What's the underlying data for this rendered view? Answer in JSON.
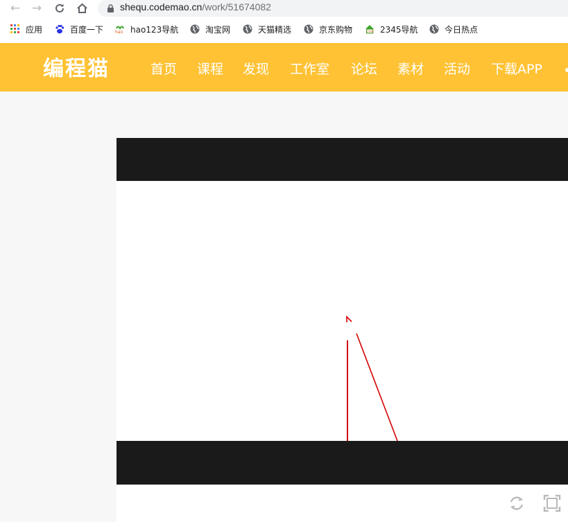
{
  "browser": {
    "url_host": "shequ.codemao.cn",
    "url_path": "/work/51674082",
    "bookmarks": [
      {
        "label": "应用",
        "icon": "apps-grid-icon"
      },
      {
        "label": "百度一下",
        "icon": "baidu-paw-icon"
      },
      {
        "label": "hao123导航",
        "icon": "hao123-icon"
      },
      {
        "label": "淘宝网",
        "icon": "globe-icon"
      },
      {
        "label": "天猫精选",
        "icon": "globe-icon"
      },
      {
        "label": "京东购物",
        "icon": "globe-icon"
      },
      {
        "label": "2345导航",
        "icon": "2345-house-icon"
      },
      {
        "label": "今日热点",
        "icon": "globe-icon"
      }
    ]
  },
  "site": {
    "logo": "编程猫",
    "brand_color": "#ffc234",
    "nav": [
      "首页",
      "课程",
      "发现",
      "工作室",
      "论坛",
      "素材",
      "活动",
      "下载APP"
    ]
  },
  "player": {
    "bar_color": "#1a1a1a",
    "stroke_color": "#d40000",
    "controls": [
      {
        "name": "restart",
        "icon": "restart-icon"
      },
      {
        "name": "fullscreen",
        "icon": "fullscreen-icon"
      }
    ]
  }
}
